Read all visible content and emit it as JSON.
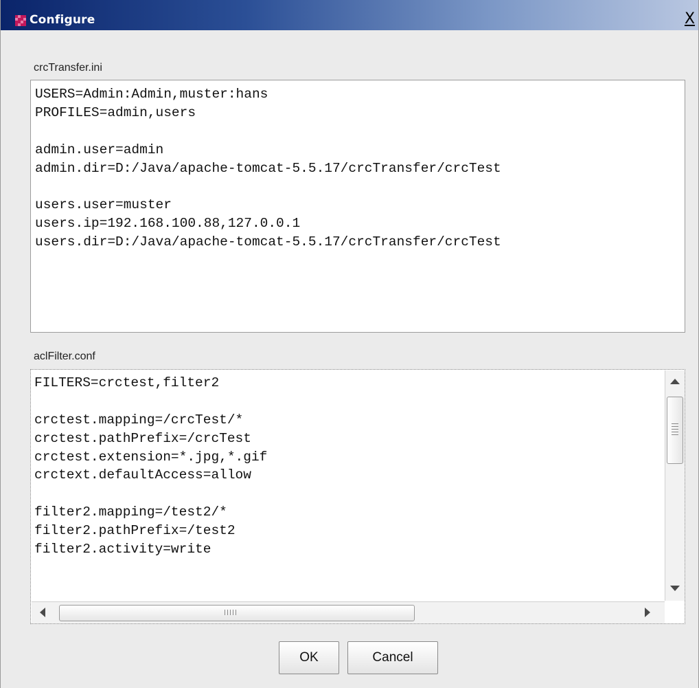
{
  "window": {
    "title": "Configure",
    "close_label": "X"
  },
  "colors": {
    "titlebar_start": "#0a246a",
    "titlebar_end": "#b9c7e1",
    "icon_primary": "#c2185b",
    "icon_secondary": "#e57ba8"
  },
  "icons": {
    "app": "configure-app-icon",
    "close": "close-icon"
  },
  "crc": {
    "label": "crcTransfer.ini",
    "lines": [
      "USERS=Admin:Admin,muster:hans",
      "PROFILES=admin,users",
      "",
      "admin.user=admin",
      "admin.dir=D:/Java/apache-tomcat-5.5.17/crcTransfer/crcTest",
      "",
      "users.user=muster",
      "users.ip=192.168.100.88,127.0.0.1",
      "users.dir=D:/Java/apache-tomcat-5.5.17/crcTransfer/crcTest"
    ]
  },
  "acl": {
    "label": "aclFilter.conf",
    "lines": [
      "FILTERS=crctest,filter2",
      "",
      "crctest.mapping=/crcTest/*",
      "crctest.pathPrefix=/crcTest",
      "crctest.extension=*.jpg,*.gif",
      "crctext.defaultAccess=allow",
      "",
      "filter2.mapping=/test2/*",
      "filter2.pathPrefix=/test2",
      "filter2.activity=write"
    ]
  },
  "buttons": {
    "ok": "OK",
    "cancel": "Cancel"
  }
}
